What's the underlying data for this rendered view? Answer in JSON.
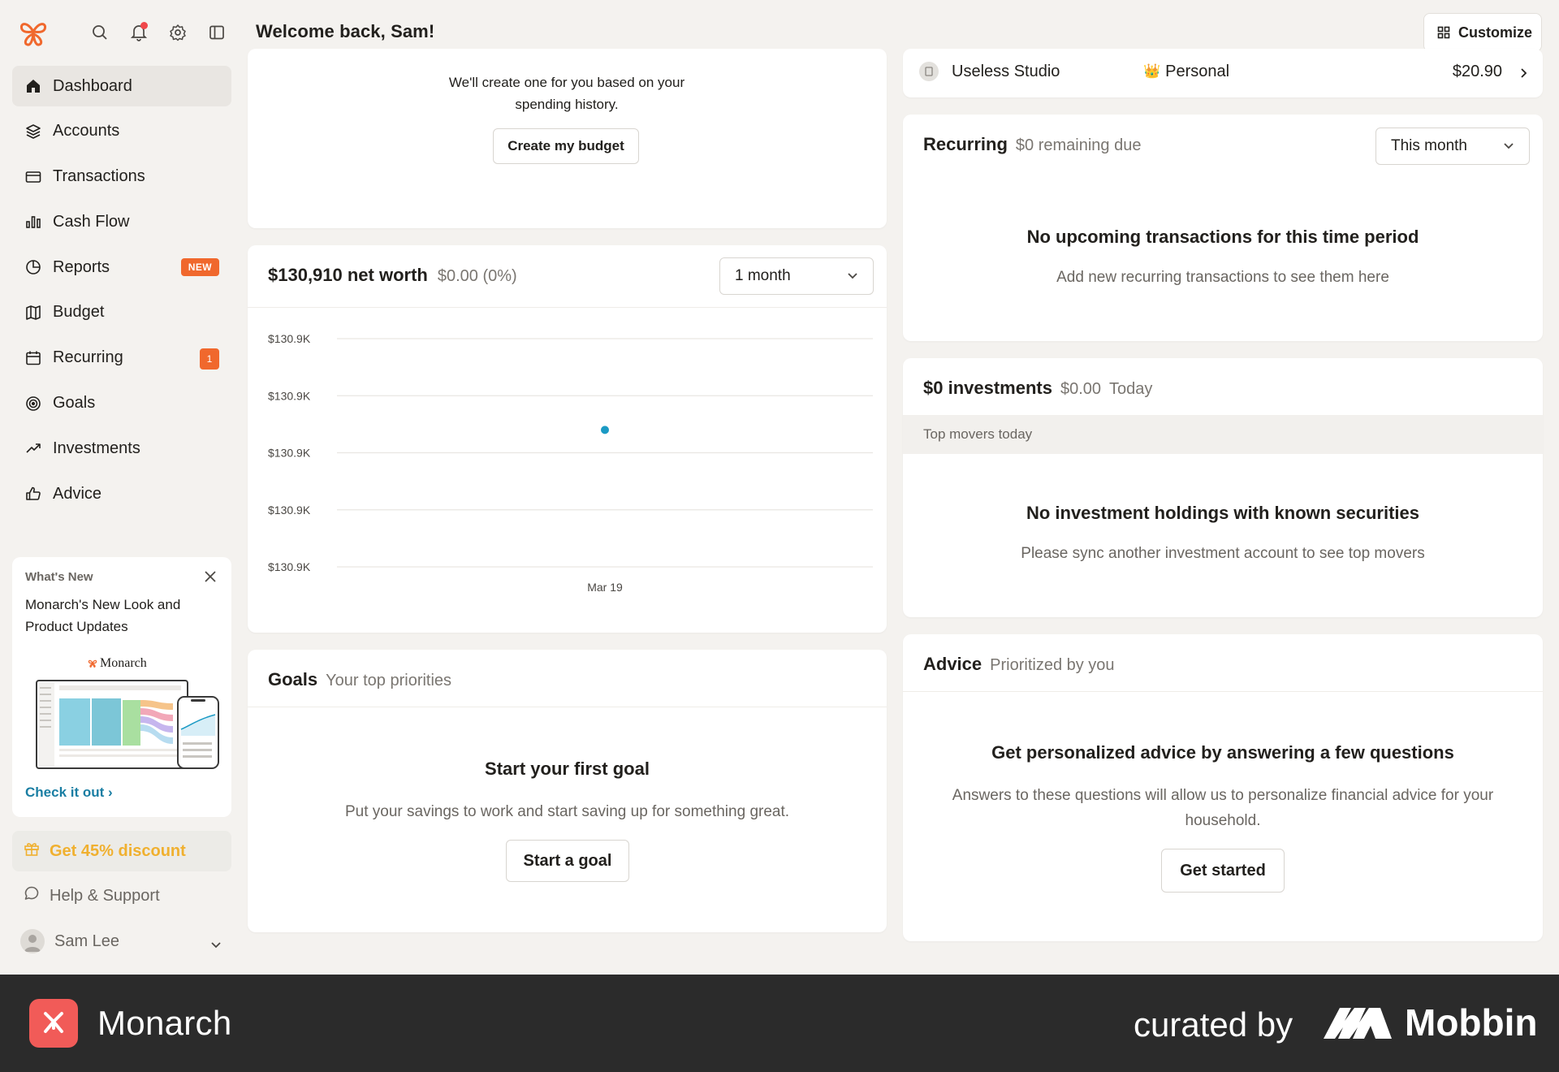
{
  "header": {
    "welcome": "Welcome back, Sam!",
    "customize_label": "Customize"
  },
  "sidebar": {
    "items": [
      {
        "label": "Dashboard",
        "icon": "home-icon"
      },
      {
        "label": "Accounts",
        "icon": "layers-icon"
      },
      {
        "label": "Transactions",
        "icon": "credit-card-icon"
      },
      {
        "label": "Cash Flow",
        "icon": "bar-chart-icon"
      },
      {
        "label": "Reports",
        "icon": "pie-chart-icon",
        "badge": "NEW"
      },
      {
        "label": "Budget",
        "icon": "map-icon"
      },
      {
        "label": "Recurring",
        "icon": "calendar-icon",
        "badge": "1"
      },
      {
        "label": "Goals",
        "icon": "target-icon"
      },
      {
        "label": "Investments",
        "icon": "trending-up-icon"
      },
      {
        "label": "Advice",
        "icon": "thumbs-up-icon"
      }
    ],
    "whats_new": {
      "heading": "What's New",
      "title": "Monarch's New Look and Product Updates",
      "brand": "Monarch",
      "link": "Check it out"
    },
    "discount_label": "Get 45% discount",
    "help_label": "Help & Support",
    "user_name": "Sam Lee"
  },
  "budget_card": {
    "text": "We'll create one for you based on your spending history.",
    "button": "Create my budget"
  },
  "net_worth": {
    "title": "$130,910 net worth",
    "change": "$0.00 (0%)",
    "range": "1 month"
  },
  "chart_data": {
    "type": "scatter",
    "title": "",
    "xlabel": "",
    "ylabel": "",
    "y_tick_labels": [
      "$130.9K",
      "$130.9K",
      "$130.9K",
      "$130.9K",
      "$130.9K"
    ],
    "x_tick_labels": [
      "Mar 19"
    ],
    "series": [
      {
        "x": [
          "Mar 19"
        ],
        "values": [
          130910
        ]
      }
    ],
    "point_color": "#1b9ac4",
    "grid": true
  },
  "goals": {
    "title": "Goals",
    "subtitle": "Your top priorities",
    "empty_title": "Start your first goal",
    "empty_text": "Put your savings to work and start saving up for something great.",
    "button": "Start a goal"
  },
  "summary_row": {
    "merchant": "Useless Studio",
    "category_emoji": "👑",
    "category": "Personal",
    "amount": "$20.90"
  },
  "recurring": {
    "title": "Recurring",
    "subtitle": "$0 remaining due",
    "period": "This month",
    "empty_title": "No upcoming transactions for this time period",
    "empty_text": "Add new recurring transactions to see them here"
  },
  "investments": {
    "title": "$0 investments",
    "value": "$0.00",
    "period": "Today",
    "movers_label": "Top movers today",
    "empty_title": "No investment holdings with known securities",
    "empty_text": "Please sync another investment account to see top movers"
  },
  "advice": {
    "title": "Advice",
    "subtitle": "Prioritized by you",
    "empty_title": "Get personalized advice by answering a few questions",
    "empty_text": "Answers to these questions will allow us to personalize financial advice for your household.",
    "button": "Get started"
  },
  "footer": {
    "app_name": "Monarch",
    "curated": "curated by",
    "mobbin": "Mobbin"
  },
  "colors": {
    "accent_orange": "#f0682d",
    "discount_yellow": "#f0b02f",
    "link_blue": "#1a7ea3",
    "chart_point": "#1b9ac4",
    "footer_bg": "#2b2b2b",
    "footer_logo": "#f15b58"
  }
}
